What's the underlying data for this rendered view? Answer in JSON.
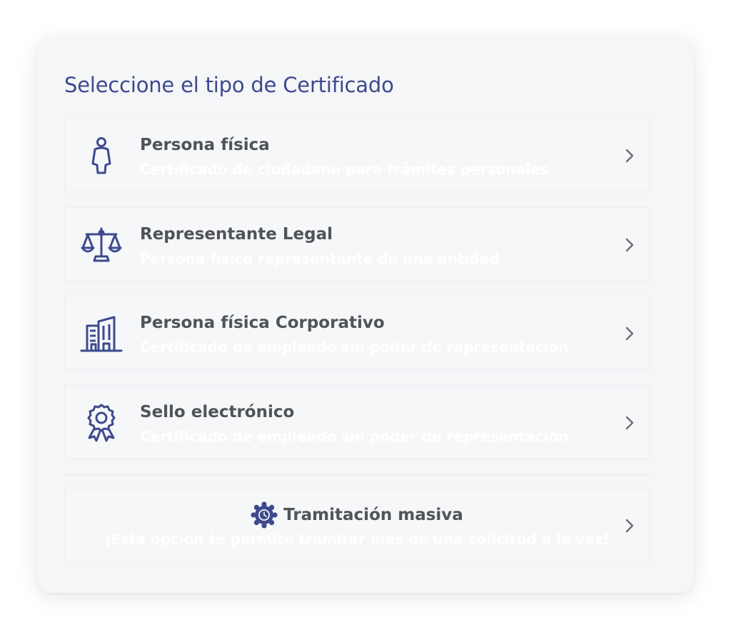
{
  "page": {
    "title": "Seleccione el tipo de Certificado"
  },
  "options": [
    {
      "title": "Persona física",
      "subtitle": "Certificado de ciudadano para trámites personales",
      "icon": "person-icon"
    },
    {
      "title": "Representante Legal",
      "subtitle": "Persona física representante de una entidad",
      "icon": "scales-icon"
    },
    {
      "title": "Persona física Corporativo",
      "subtitle": "Certificado de empleado sin poder de representación",
      "icon": "building-icon"
    },
    {
      "title": "Sello electrónico",
      "subtitle": "Certificado de empleado sin poder de representación",
      "icon": "award-seal-icon"
    }
  ],
  "masiva": {
    "title": "Tramitación masiva",
    "subtitle": "¡Esta opción te permite tramitar más de una solicitud a la vez!",
    "icon": "gear-clock-icon"
  },
  "colors": {
    "accent": "#3d4a8f",
    "text": "#505357",
    "card_bg": "#f5f6f7",
    "chevron": "#6b6e72"
  }
}
